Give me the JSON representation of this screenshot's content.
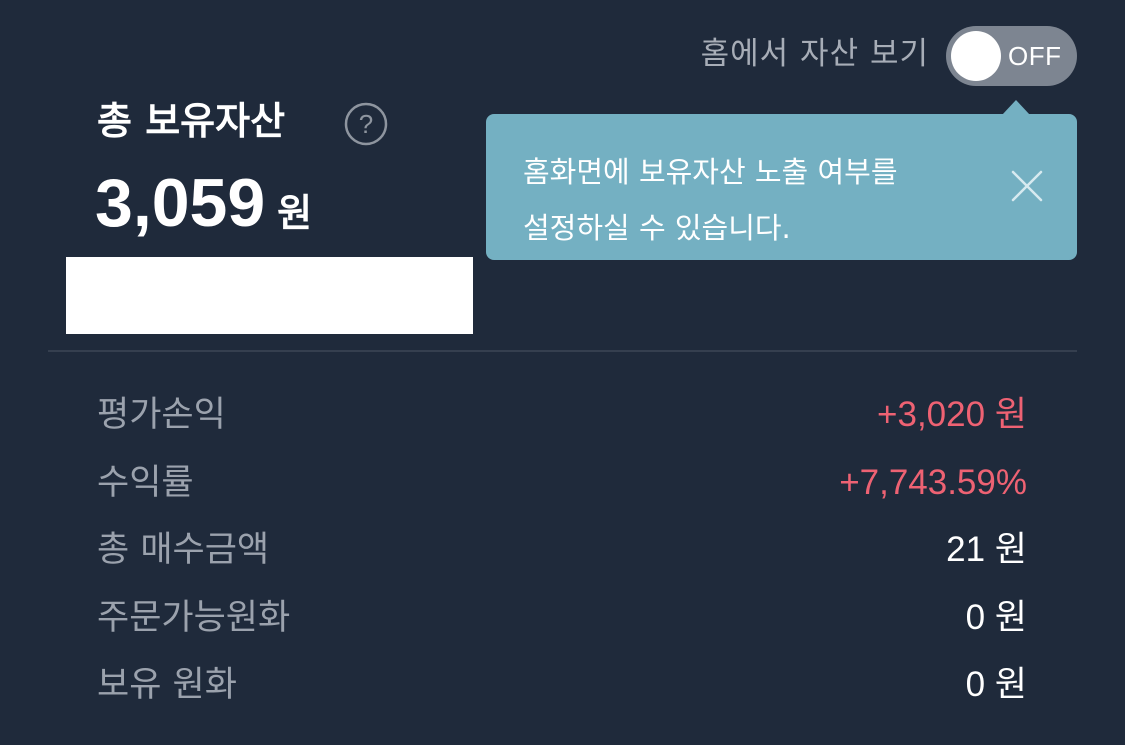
{
  "home_toggle": {
    "label": "홈에서 자산 보기",
    "state_text": "OFF",
    "enabled": false
  },
  "tooltip": {
    "line1": "홈화면에 보유자산 노출 여부를",
    "line2": "설정하실 수 있습니다.",
    "close_icon": "close-icon"
  },
  "summary": {
    "title": "총 보유자산",
    "help_icon": "question-circle-icon",
    "amount": "3,059",
    "unit": "원"
  },
  "details": [
    {
      "label": "평가손익",
      "value": "+3,020 원",
      "tone": "positive"
    },
    {
      "label": "수익률",
      "value": "+7,743.59%",
      "tone": "positive"
    },
    {
      "label": "총 매수금액",
      "value": "21 원",
      "tone": "neutral"
    },
    {
      "label": "주문가능원화",
      "value": "0 원",
      "tone": "neutral"
    },
    {
      "label": "보유 원화",
      "value": "0 원",
      "tone": "neutral"
    }
  ],
  "colors": {
    "background": "#1f2a3b",
    "tooltip": "#74b0c2",
    "positive": "#ee6273",
    "label": "#9ba2ad",
    "toggle_off": "#7d8591"
  }
}
